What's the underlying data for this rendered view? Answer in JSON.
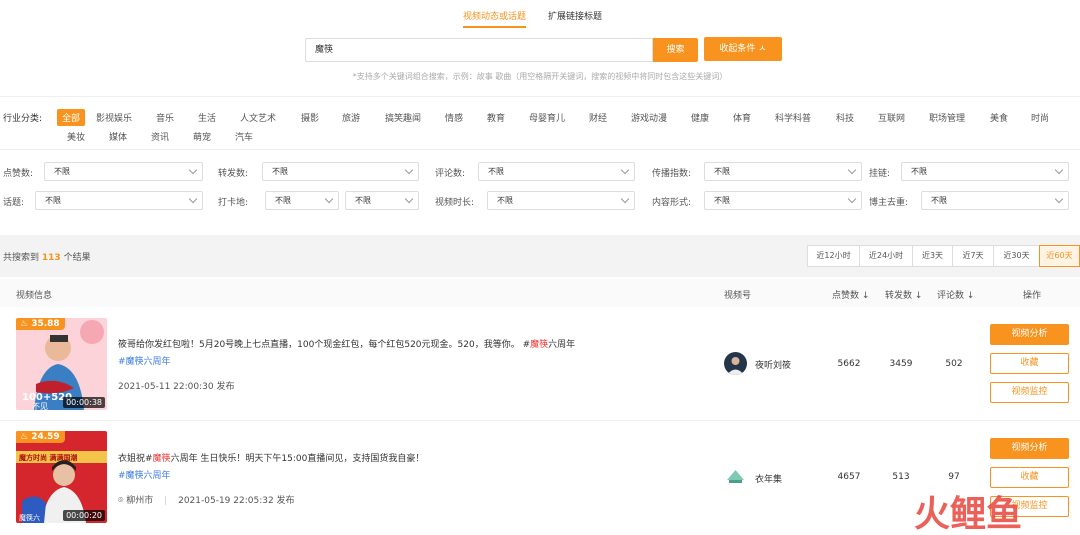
{
  "tabs": [
    {
      "label": "视频动态或话题",
      "active": true
    },
    {
      "label": "扩展链接标题",
      "active": false
    }
  ],
  "search": {
    "value": "魔筷",
    "button": "搜索",
    "collapse": "收起条件 ㅅ",
    "hint": "*支持多个关键词组合搜索，示例：故事 歌曲（用空格隔开关键词，搜索的视频中将同时包含这些关键词）"
  },
  "industry": {
    "label": "行业分类:",
    "row1": [
      "全部",
      "影视娱乐",
      "音乐",
      "生活",
      "人文艺术",
      "摄影",
      "旅游",
      "搞笑趣闻",
      "情感",
      "教育",
      "母婴育儿",
      "财经",
      "游戏动漫",
      "健康",
      "体育",
      "科学科普",
      "科技",
      "互联网",
      "职场管理",
      "美食",
      "时尚"
    ],
    "row2": [
      "美妆",
      "媒体",
      "资讯",
      "萌宠",
      "汽车"
    ]
  },
  "filters": {
    "row1": [
      {
        "label": "点赞数:",
        "value": "不限"
      },
      {
        "label": "转发数:",
        "value": "不限"
      },
      {
        "label": "评论数:",
        "value": "不限"
      },
      {
        "label": "传播指数:",
        "value": "不限"
      },
      {
        "label": "挂链:",
        "value": "不限"
      }
    ],
    "row2": [
      {
        "label": "话题:",
        "value": "不限"
      },
      {
        "label": "打卡地:",
        "value": "不限",
        "value2": "不限"
      },
      {
        "label": "视频时长:",
        "value": "不限"
      },
      {
        "label": "内容形式:",
        "value": "不限"
      },
      {
        "label": "博主去重:",
        "value": "不限"
      }
    ]
  },
  "results": {
    "prefix": "共搜索到",
    "count": "113",
    "suffix": "个结果",
    "time_ranges": [
      "近12小时",
      "近24小时",
      "近3天",
      "近7天",
      "近30天",
      "近60天"
    ],
    "active_range": "近60天"
  },
  "columns": {
    "info": "视频信息",
    "account": "视频号",
    "likes": "点赞数 ↓",
    "shares": "转发数 ↓",
    "comments": "评论数 ↓",
    "ops": "操作"
  },
  "rows": [
    {
      "score": "35.88",
      "duration": "00:00:38",
      "title_pre": "筱哥给你发红包啦！5月20号晚上七点直播，100个现金红包，每个红包520元现金。520，我等你。 #",
      "title_hl": "魔筷",
      "title_post": "六周年",
      "tag": "#魔筷六周年",
      "date": "2021-05-11 22:00:30 发布",
      "account": "夜听刘筱",
      "likes": "5662",
      "shares": "3459",
      "comments": "502",
      "ops": [
        "视频分析",
        "收藏",
        "视频监控"
      ]
    },
    {
      "score": "24.59",
      "duration": "00:00:20",
      "title_pre": "衣姐祝#",
      "title_hl": "魔筷",
      "title_post": "六周年 生日快乐！明天下午15:00直播间见，支持国货我自豪！",
      "tag": "#魔筷六周年",
      "location": "柳州市",
      "date": "2021-05-19 22:05:32 发布",
      "account": "衣年集",
      "likes": "4657",
      "shares": "513",
      "comments": "97",
      "ops": [
        "视频分析",
        "收藏",
        "视频监控"
      ]
    }
  ],
  "watermark": "火鲤鱼",
  "colors": {
    "accent": "#f7931e",
    "tag": "#3c7be4",
    "highlight": "#e33333"
  }
}
